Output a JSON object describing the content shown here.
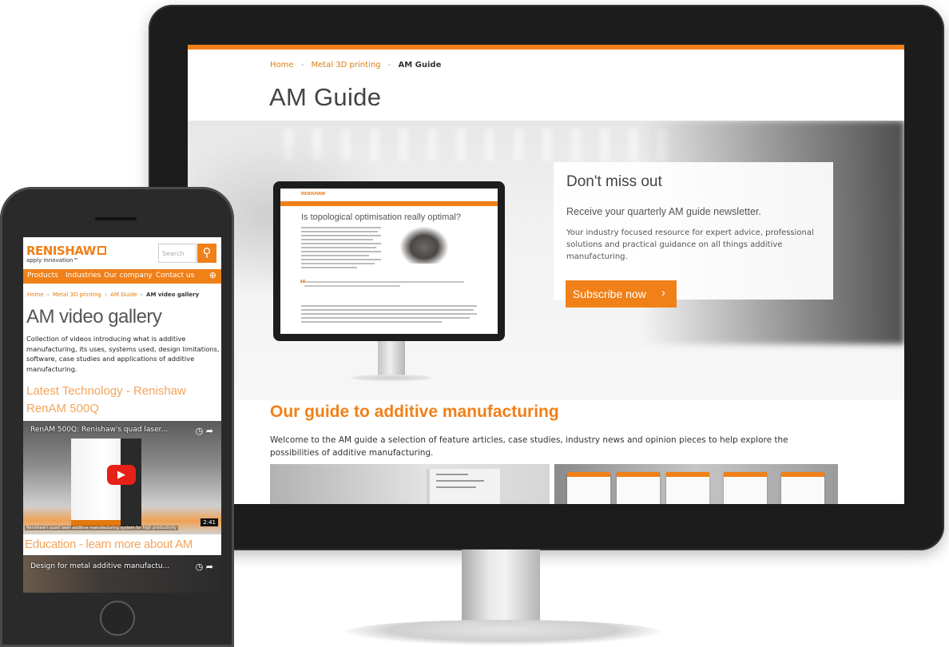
{
  "desktop": {
    "breadcrumb": {
      "home": "Home",
      "sep": "-",
      "parent": "Metal 3D printing",
      "current": "AM Guide"
    },
    "page_title": "AM Guide",
    "hero_mini_screen": {
      "logo": "RENISHAW",
      "title": "Is topological optimisation really optimal?"
    },
    "newsletter": {
      "title": "Don't miss out",
      "subtitle": "Receive your quarterly AM guide newsletter.",
      "body": "Your industry focused resource for expert advice, professional solutions and practical guidance on all things additive manufacturing.",
      "button_label": "Subscribe now",
      "button_chevron": "›"
    },
    "guide": {
      "title": "Our guide to additive manufacturing",
      "text": "Welcome to the AM guide a selection of feature articles, case studies, industry news and opinion pieces to help explore the possibilities of additive manufacturing."
    },
    "colors": {
      "accent": "#f08018",
      "text": "#444444"
    }
  },
  "mobile": {
    "logo": "RENISHAW",
    "tagline": "apply innovation™",
    "search_placeholder": "Search",
    "search_icon": "⚲",
    "nav": [
      "Products",
      "Industries",
      "Our company",
      "Contact us"
    ],
    "globe_icon": "⊕",
    "breadcrumb": {
      "home": "Home",
      "parent": "Metal 3D printing",
      "section": "AM Guide",
      "current": "AM video gallery",
      "sep": "›"
    },
    "title": "AM video gallery",
    "description": "Collection of videos introducing what is additive manufacturing, its uses, systems used, design limitations, software, case studies and applications of additive manufacturing.",
    "section1": "Latest Technology - Renishaw RenAM 500Q",
    "video1": {
      "title": "RenAM 500Q: Renishaw's quad laser...",
      "duration": "2:41",
      "caption": "Renishaw's quad laser additive manufacturing system for high productivity",
      "play_icon": "▶",
      "clock_icon": "◷",
      "share_icon": "➦"
    },
    "section2": "Education - learn more about AM",
    "video2": {
      "title": "Design for metal additive manufactu...",
      "clock_icon": "◷",
      "share_icon": "➦"
    }
  }
}
